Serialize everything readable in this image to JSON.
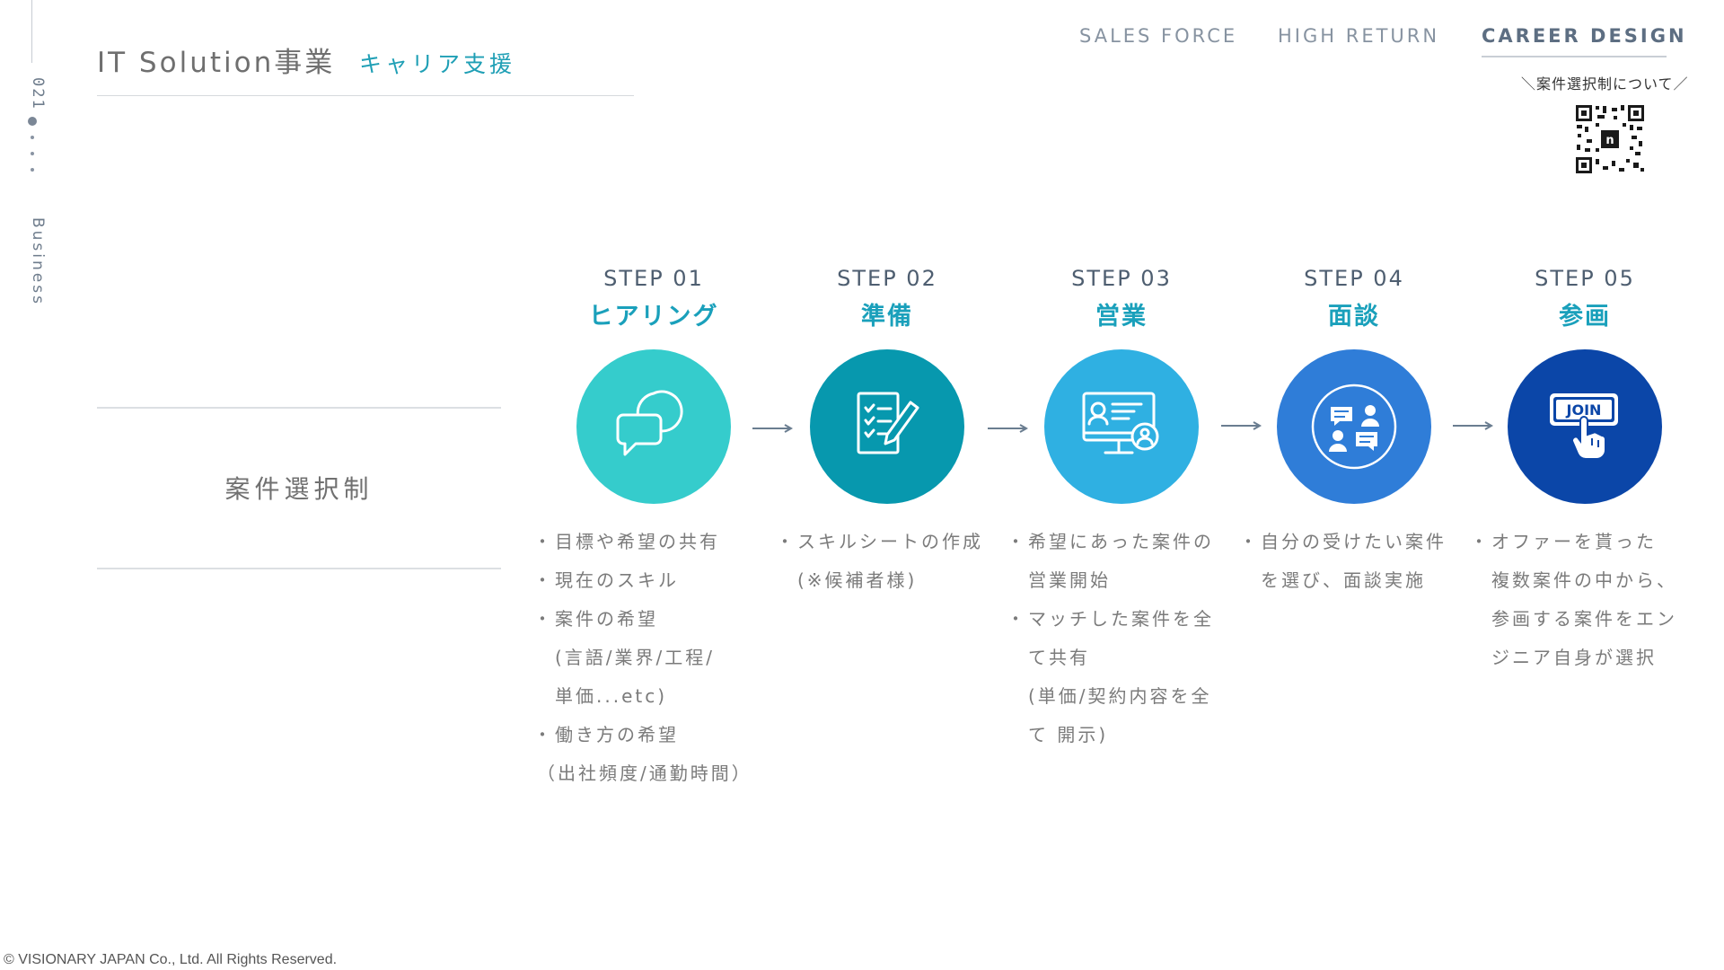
{
  "rail": {
    "page_number": "021",
    "section": "Business"
  },
  "header": {
    "title": "IT Solution事業",
    "subtitle": "キャリア支援"
  },
  "nav": {
    "sales": "SALES FORCE",
    "high": "HIGH RETURN",
    "career": "CAREER DESIGN"
  },
  "qr": {
    "caption": "＼案件選択制について／",
    "badge": "n"
  },
  "section": {
    "label": "案件選択制"
  },
  "steps": [
    {
      "no": "STEP 01",
      "name": "ヒアリング",
      "color": "#35cccc",
      "icon": "chat-bubbles-icon",
      "items": [
        "目標や希望の共有",
        "現在のスキル",
        "案件の希望",
        "(言語/業界/工程/",
        "単価...etc)",
        "働き方の希望",
        "（出社頻度/通勤時間）"
      ]
    },
    {
      "no": "STEP 02",
      "name": "準備",
      "color": "#0798ae",
      "icon": "document-pen-icon",
      "items": [
        "スキルシートの作成",
        "(※候補者様)"
      ]
    },
    {
      "no": "STEP 03",
      "name": "営業",
      "color": "#2fb0e2",
      "icon": "monitor-profile-icon",
      "items": [
        "希望にあった案件の",
        "営業開始",
        "マッチした案件を全",
        "て共有",
        "(単価/契約内容を全",
        "て 開示)"
      ]
    },
    {
      "no": "STEP 04",
      "name": "面談",
      "color": "#2f7dd8",
      "icon": "meeting-icon",
      "items": [
        "自分の受けたい案件",
        "を選び、面談実施"
      ]
    },
    {
      "no": "STEP 05",
      "name": "参画",
      "color": "#0b46a8",
      "icon": "join-button-icon",
      "join_text": "JOIN",
      "items": [
        "オファーを貰った",
        "複数案件の中から、",
        "参画する案件をエン",
        "ジニア自身が選択"
      ]
    }
  ],
  "footer": {
    "copyright": "© VISIONARY JAPAN Co., Ltd. All Rights Reserved."
  }
}
